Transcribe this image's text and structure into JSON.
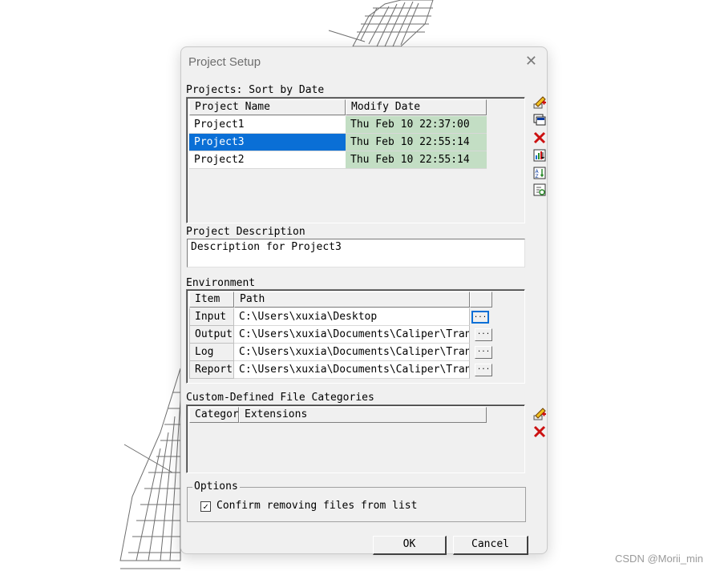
{
  "watermark": "CSDN @Morii_min",
  "dialog": {
    "title": "Project Setup",
    "close_glyph": "✕"
  },
  "projects": {
    "label": "Projects: Sort by Date",
    "columns": [
      "Project Name",
      "Modify Date"
    ],
    "rows": [
      {
        "name": "Project1",
        "date": "Thu Feb 10 22:37:00"
      },
      {
        "name": "Project3",
        "date": "Thu Feb 10 22:55:14"
      },
      {
        "name": "Project2",
        "date": "Thu Feb 10 22:55:14"
      }
    ],
    "selected_row": "Project3"
  },
  "description": {
    "label": "Project Description",
    "value": "Description for Project3"
  },
  "environment": {
    "label": "Environment",
    "columns": [
      "Item",
      "Path"
    ],
    "rows": [
      {
        "item": "Input",
        "path": "C:\\Users\\xuxia\\Desktop"
      },
      {
        "item": "Output",
        "path": "C:\\Users\\xuxia\\Documents\\Caliper\\TransCAD"
      },
      {
        "item": "Log",
        "path": "C:\\Users\\xuxia\\Documents\\Caliper\\TransCAD"
      },
      {
        "item": "Report",
        "path": "C:\\Users\\xuxia\\Documents\\Caliper\\TransCAD"
      }
    ],
    "browse_label": "..."
  },
  "categories": {
    "label": "Custom-Defined File Categories",
    "columns": [
      "Category",
      "Extensions"
    ]
  },
  "options": {
    "label": "Options",
    "confirm_label": "Confirm removing files from list",
    "confirm_checked": true,
    "check_glyph": "✓"
  },
  "buttons": {
    "ok": "OK",
    "cancel": "Cancel"
  },
  "icons": {
    "add": "add-project-icon",
    "copy": "copy-project-icon",
    "delete": "delete-icon",
    "sort_date": "sort-by-date-icon",
    "sort_name": "sort-by-name-icon",
    "refresh": "refresh-icon",
    "accent_red": "#cc1111",
    "accent_blue": "#0a6fd6",
    "accent_green": "#2a8a2a"
  }
}
